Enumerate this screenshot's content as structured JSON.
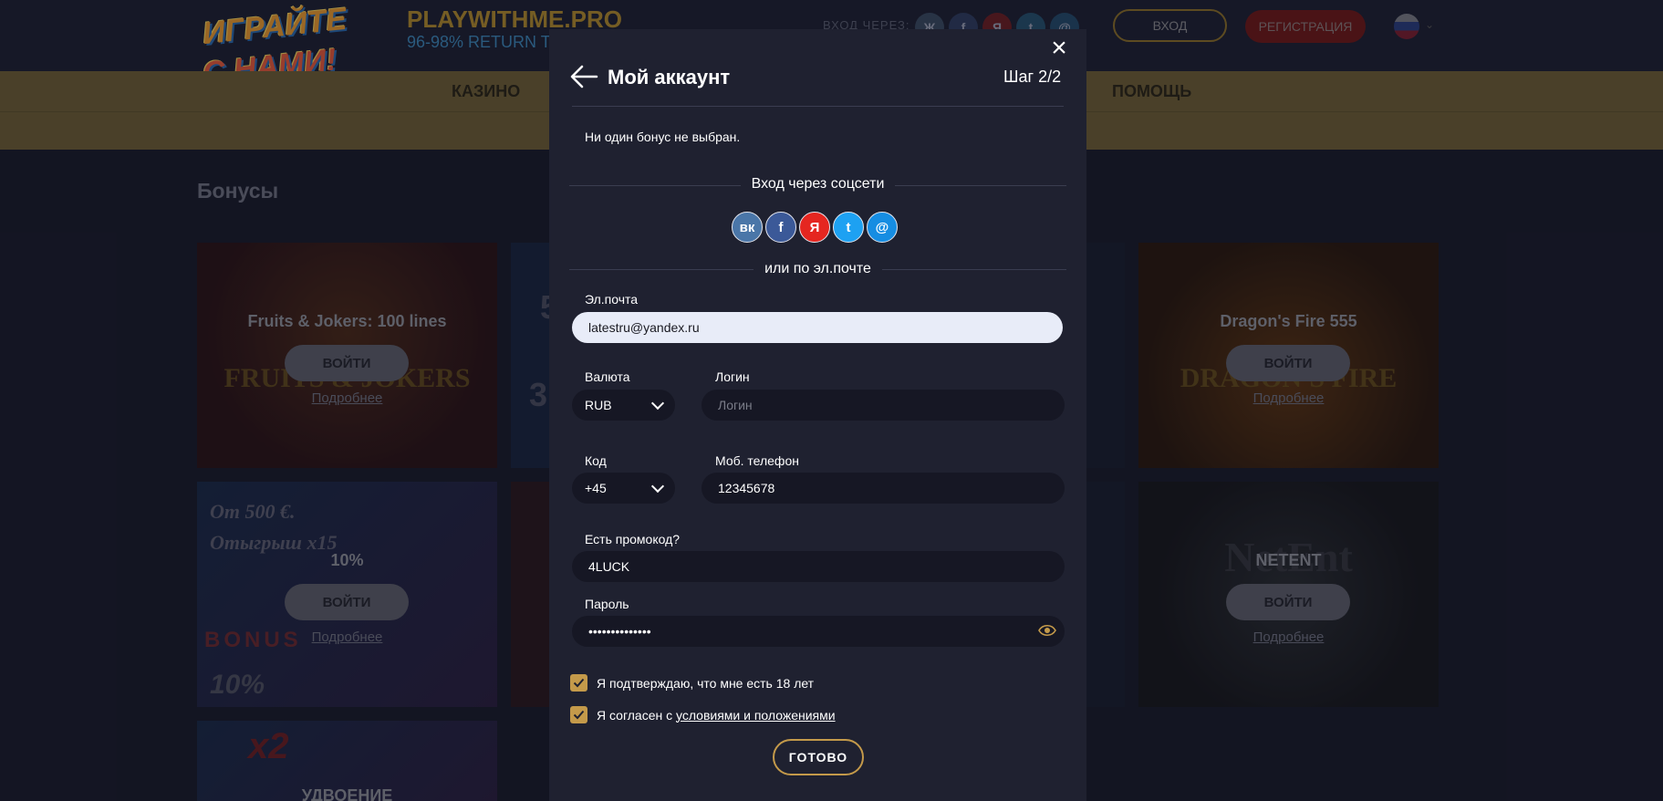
{
  "site": {
    "logo_line1": "ИГРАЙТЕ",
    "logo_line2": "С НАМИ!",
    "brand": "PLAYWITHME.PRO",
    "tagline": "96-98% RETURN T",
    "login_via": "ВХОД ЧЕРЕЗ:",
    "header_socials": [
      "Ж",
      "f",
      "Я",
      "t",
      "@"
    ],
    "login_button": "ВХОД",
    "register_button": "РЕГИСТРАЦИЯ",
    "nav": [
      "КАЗИНО",
      "ПОМОЩЬ"
    ],
    "page_title": "Бонусы"
  },
  "cards": [
    {
      "title": "Fruits & Jokers: 100 lines",
      "button": "ВОЙТИ",
      "more": "Подробнее",
      "art": "FRUITS & JOKERS"
    },
    {
      "title": "Dragon's Fire 555",
      "button": "ВОЙТИ",
      "more": "Подробнее",
      "art": "DRAGON'S FIRE"
    },
    {
      "title": "10%",
      "button": "ВОЙТИ",
      "more": "Подробнее",
      "art": "От 500 €. Отыгрыш х15"
    },
    {
      "title": "NETENT",
      "button": "ВОЙТИ",
      "more": "Подробнее",
      "art": "NetEnt"
    },
    {
      "title": "УДВОЕНИЕ",
      "art": "x2"
    }
  ],
  "card_art_extra": {
    "bonus_word": "BONUS",
    "bonus_pct": "10%",
    "peek_a": "5",
    "peek_b": "3"
  },
  "modal": {
    "title": "Мой аккаунт",
    "step": "Шаг 2/2",
    "no_bonus": "Ни один бонус не выбран.",
    "social_title": "Вход через соцсети",
    "social_icons": [
      {
        "name": "vk-icon",
        "glyph": "вк",
        "color": "#4a76a8"
      },
      {
        "name": "facebook-icon",
        "glyph": "f",
        "color": "#3b5998"
      },
      {
        "name": "yandex-icon",
        "glyph": "Я",
        "color": "#e52620"
      },
      {
        "name": "twitter-icon",
        "glyph": "t",
        "color": "#1da1f2"
      },
      {
        "name": "mailru-icon",
        "glyph": "@",
        "color": "#168de2"
      }
    ],
    "or_email": "или по эл.почте",
    "email_label": "Эл.почта",
    "email_value": "latestru@yandex.ru",
    "currency_label": "Валюта",
    "currency_value": "RUB",
    "login_label": "Логин",
    "login_placeholder": "Логин",
    "code_label": "Код",
    "code_value": "+45",
    "phone_label": "Моб. телефон",
    "phone_value": "12345678",
    "promo_label": "Есть промокод?",
    "promo_value": "4LUCK",
    "password_label": "Пароль",
    "password_value": "••••••••••••••",
    "age_confirm": "Я подтверждаю, что мне есть 18 лет",
    "agree_prefix": "Я согласен с ",
    "agree_link": "условиями и положениями",
    "done_button": "ГОТОВО",
    "accent": "#c49a4a"
  }
}
